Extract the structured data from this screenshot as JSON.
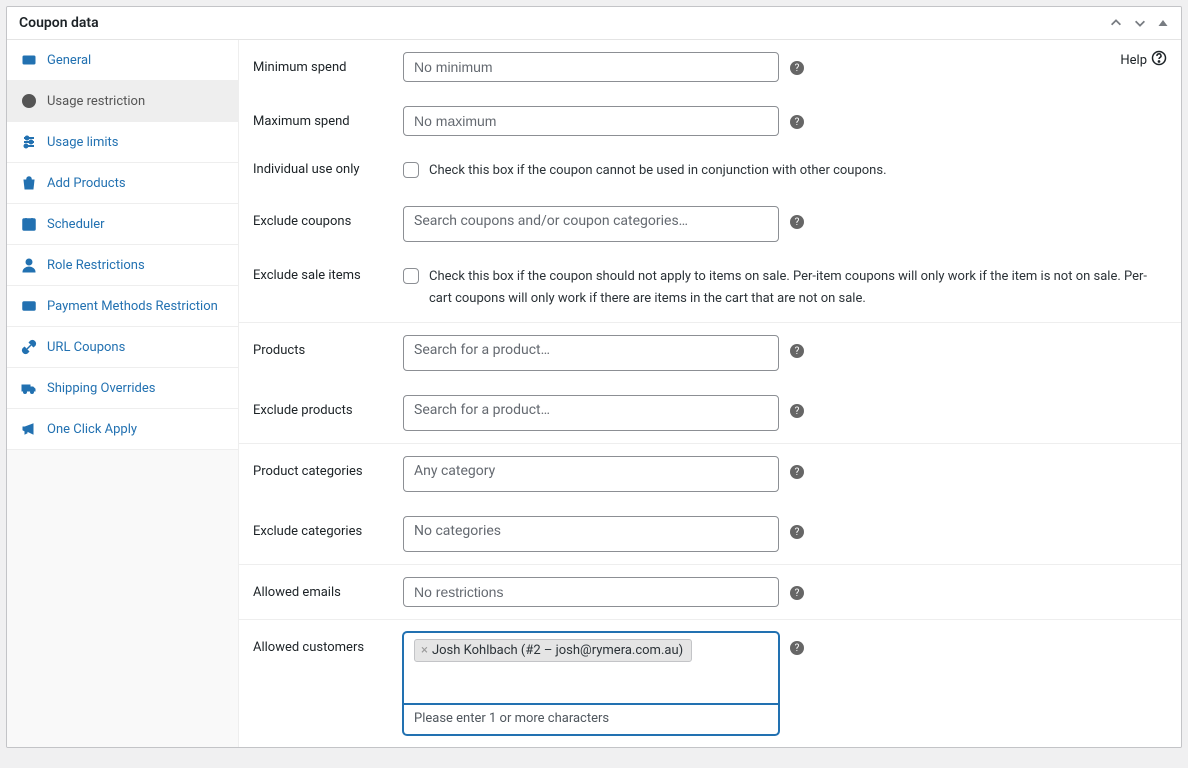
{
  "panel": {
    "title": "Coupon data"
  },
  "help": {
    "label": "Help"
  },
  "sidebar": {
    "items": [
      {
        "icon": "ticket",
        "label": "General"
      },
      {
        "icon": "block",
        "label": "Usage restriction"
      },
      {
        "icon": "sliders",
        "label": "Usage limits"
      },
      {
        "icon": "bag",
        "label": "Add Products"
      },
      {
        "icon": "calendar",
        "label": "Scheduler"
      },
      {
        "icon": "person",
        "label": "Role Restrictions"
      },
      {
        "icon": "card",
        "label": "Payment Methods Restriction"
      },
      {
        "icon": "link",
        "label": "URL Coupons"
      },
      {
        "icon": "truck",
        "label": "Shipping Overrides"
      },
      {
        "icon": "megaphone",
        "label": "One Click Apply"
      }
    ],
    "activeIndex": 1
  },
  "form": {
    "minimum_spend": {
      "label": "Minimum spend",
      "placeholder": "No minimum"
    },
    "maximum_spend": {
      "label": "Maximum spend",
      "placeholder": "No maximum"
    },
    "individual_use": {
      "label": "Individual use only",
      "text": "Check this box if the coupon cannot be used in conjunction with other coupons."
    },
    "exclude_coupons": {
      "label": "Exclude coupons",
      "placeholder": "Search coupons and/or coupon categories…"
    },
    "exclude_sale_items": {
      "label": "Exclude sale items",
      "text": "Check this box if the coupon should not apply to items on sale. Per-item coupons will only work if the item is not on sale. Per-cart coupons will only work if there are items in the cart that are not on sale."
    },
    "products": {
      "label": "Products",
      "placeholder": "Search for a product…"
    },
    "exclude_products": {
      "label": "Exclude products",
      "placeholder": "Search for a product…"
    },
    "product_categories": {
      "label": "Product categories",
      "placeholder": "Any category"
    },
    "exclude_categories": {
      "label": "Exclude categories",
      "placeholder": "No categories"
    },
    "allowed_emails": {
      "label": "Allowed emails",
      "placeholder": "No restrictions"
    },
    "allowed_customers": {
      "label": "Allowed customers",
      "tags": [
        "Josh Kohlbach (#2 – josh@rymera.com.au)"
      ],
      "prompt": "Please enter 1 or more characters"
    }
  }
}
